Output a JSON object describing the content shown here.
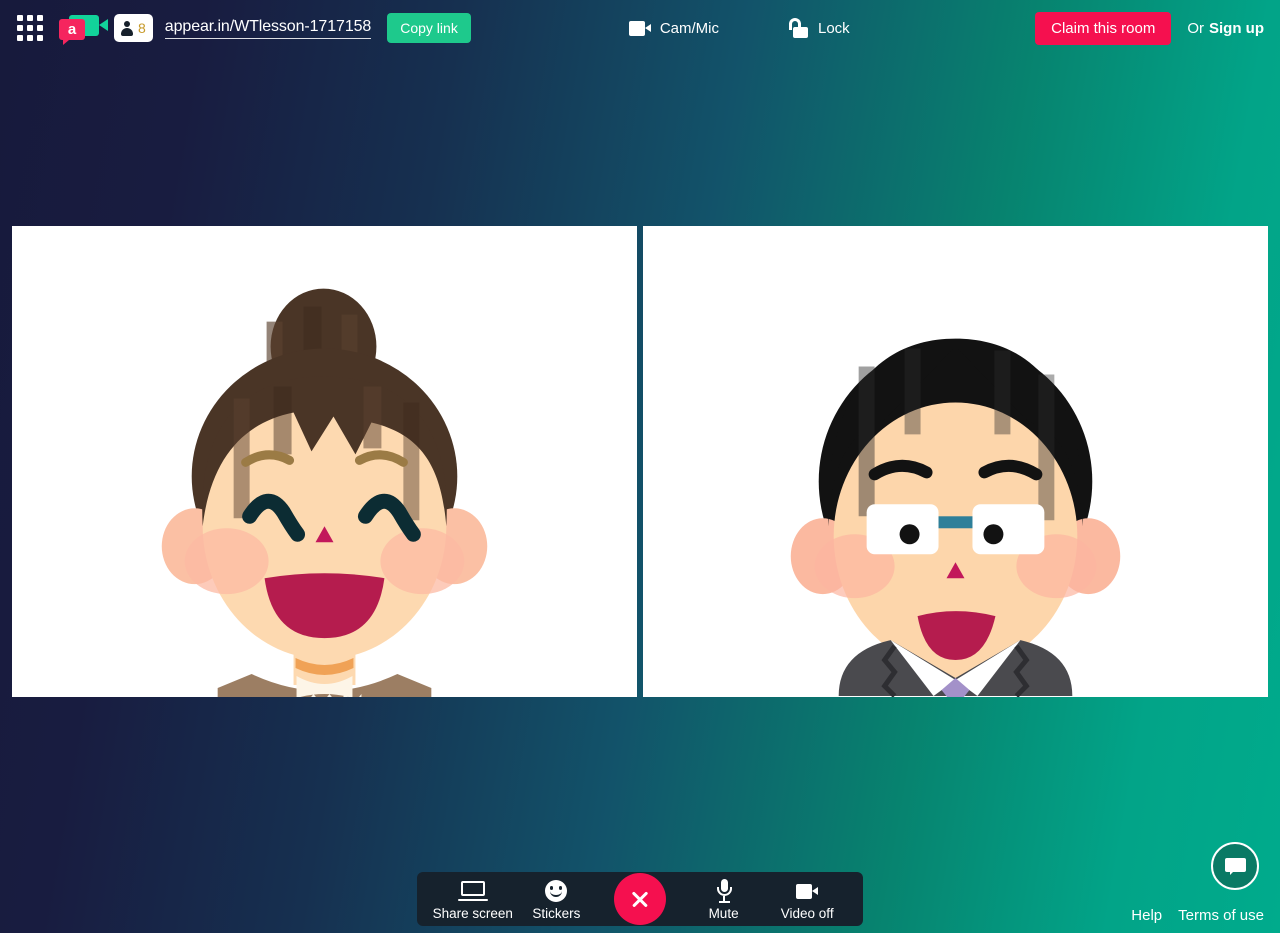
{
  "header": {
    "apps_icon": "apps-grid-icon",
    "logo": {
      "icon": "appear-in-logo",
      "letter": "a"
    },
    "participants": {
      "icon": "person-icon",
      "count": "8"
    },
    "room_url": "appear.in/WTlesson-1717158",
    "copy_link_label": "Copy link",
    "cam_mic": {
      "icon": "camera-icon",
      "label": "Cam/Mic"
    },
    "lock": {
      "icon": "unlocked-padlock-icon",
      "label": "Lock"
    },
    "claim_label": "Claim this room",
    "or_label": "Or",
    "signup_label": "Sign up"
  },
  "video_grid": {
    "tiles": [
      {
        "name": "participant-video-left",
        "person": "woman-with-hair-bun"
      },
      {
        "name": "participant-video-right",
        "person": "man-with-glasses-in-suit"
      }
    ]
  },
  "toolbar": {
    "items": [
      {
        "icon": "laptop-icon",
        "label": "Share screen"
      },
      {
        "icon": "smiley-icon",
        "label": "Stickers"
      },
      {
        "icon": "microphone-icon",
        "label": "Mute"
      },
      {
        "icon": "camera-icon",
        "label": "Video off"
      }
    ],
    "leave_icon": "close-x-icon"
  },
  "chat": {
    "icon": "chat-bubble-icon"
  },
  "footer": {
    "help_label": "Help",
    "terms_label": "Terms of use"
  },
  "colors": {
    "accent_pink": "#f5104f",
    "accent_green": "#1ec98c",
    "logo_green": "#12d39a",
    "logo_pink": "#f5255e",
    "toolbar_bg": "#16222d",
    "gradient_start": "#171a3c",
    "gradient_end": "#00ab8c"
  }
}
